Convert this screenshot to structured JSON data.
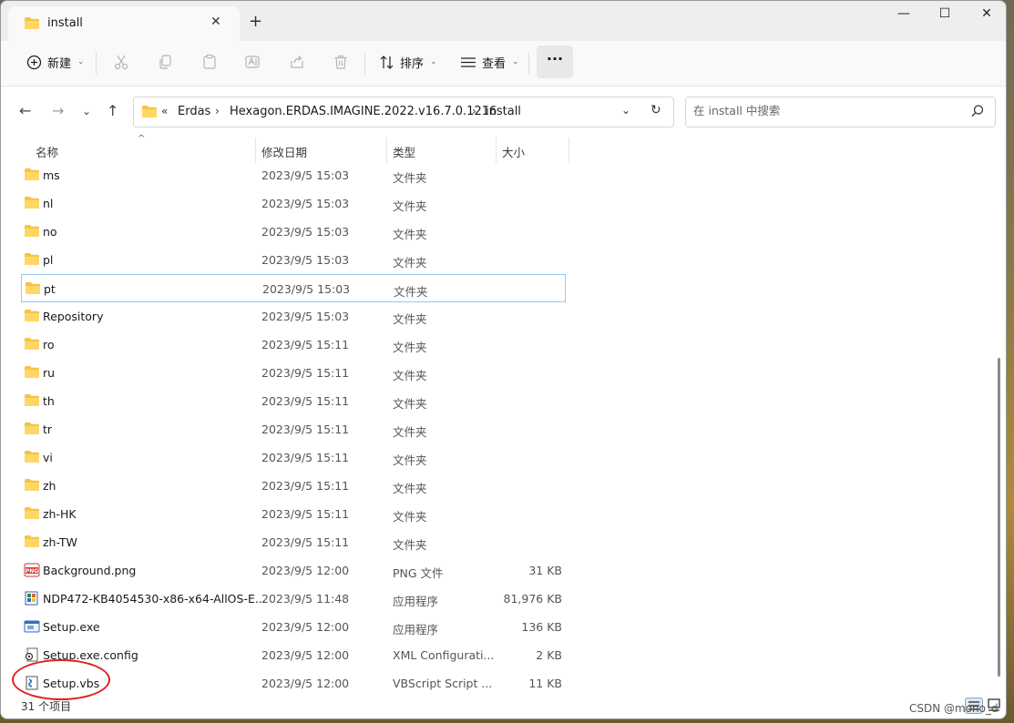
{
  "window": {
    "tab_title": "install",
    "tab_close": "✕",
    "new_tab": "+",
    "minimize": "—",
    "maximize": "☐",
    "close": "✕"
  },
  "toolbar": {
    "new_label": "新建",
    "sort_label": "排序",
    "view_label": "查看",
    "more_label": "···"
  },
  "address": {
    "overflow": "«",
    "crumbs": [
      "Erdas",
      "Hexagon.ERDAS.IMAGINE.2022.v16.7.0.1216",
      "install"
    ],
    "separator": "›"
  },
  "search": {
    "placeholder": "在 install 中搜索"
  },
  "columns": {
    "name": "名称",
    "date": "修改日期",
    "type": "类型",
    "size": "大小"
  },
  "files": [
    {
      "name": "ms",
      "date": "2023/9/5 15:03",
      "type": "文件夹",
      "size": "",
      "icon": "folder-icon"
    },
    {
      "name": "nl",
      "date": "2023/9/5 15:03",
      "type": "文件夹",
      "size": "",
      "icon": "folder-icon"
    },
    {
      "name": "no",
      "date": "2023/9/5 15:03",
      "type": "文件夹",
      "size": "",
      "icon": "folder-icon"
    },
    {
      "name": "pl",
      "date": "2023/9/5 15:03",
      "type": "文件夹",
      "size": "",
      "icon": "folder-icon"
    },
    {
      "name": "pt",
      "date": "2023/9/5 15:03",
      "type": "文件夹",
      "size": "",
      "icon": "folder-icon",
      "selected": true
    },
    {
      "name": "Repository",
      "date": "2023/9/5 15:03",
      "type": "文件夹",
      "size": "",
      "icon": "folder-icon"
    },
    {
      "name": "ro",
      "date": "2023/9/5 15:11",
      "type": "文件夹",
      "size": "",
      "icon": "folder-icon"
    },
    {
      "name": "ru",
      "date": "2023/9/5 15:11",
      "type": "文件夹",
      "size": "",
      "icon": "folder-icon"
    },
    {
      "name": "th",
      "date": "2023/9/5 15:11",
      "type": "文件夹",
      "size": "",
      "icon": "folder-icon"
    },
    {
      "name": "tr",
      "date": "2023/9/5 15:11",
      "type": "文件夹",
      "size": "",
      "icon": "folder-icon"
    },
    {
      "name": "vi",
      "date": "2023/9/5 15:11",
      "type": "文件夹",
      "size": "",
      "icon": "folder-icon"
    },
    {
      "name": "zh",
      "date": "2023/9/5 15:11",
      "type": "文件夹",
      "size": "",
      "icon": "folder-icon"
    },
    {
      "name": "zh-HK",
      "date": "2023/9/5 15:11",
      "type": "文件夹",
      "size": "",
      "icon": "folder-icon"
    },
    {
      "name": "zh-TW",
      "date": "2023/9/5 15:11",
      "type": "文件夹",
      "size": "",
      "icon": "folder-icon"
    },
    {
      "name": "Background.png",
      "date": "2023/9/5 12:00",
      "type": "PNG 文件",
      "size": "31 KB",
      "icon": "png-file-icon"
    },
    {
      "name": "NDP472-KB4054530-x86-x64-AllOS-E...",
      "date": "2023/9/5 11:48",
      "type": "应用程序",
      "size": "81,976 KB",
      "icon": "installer-icon"
    },
    {
      "name": "Setup.exe",
      "date": "2023/9/5 12:00",
      "type": "应用程序",
      "size": "136 KB",
      "icon": "exe-icon"
    },
    {
      "name": "Setup.exe.config",
      "date": "2023/9/5 12:00",
      "type": "XML Configurati...",
      "size": "2 KB",
      "icon": "config-file-icon"
    },
    {
      "name": "Setup.vbs",
      "date": "2023/9/5 12:00",
      "type": "VBScript Script ...",
      "size": "11 KB",
      "icon": "vbs-file-icon"
    }
  ],
  "status": {
    "count": "31 个项目"
  },
  "watermark": "CSDN @mono_d",
  "colors": {
    "folder": "#f6c344",
    "selection_border": "#99c9ef",
    "annotation_circle": "#e0201e"
  }
}
